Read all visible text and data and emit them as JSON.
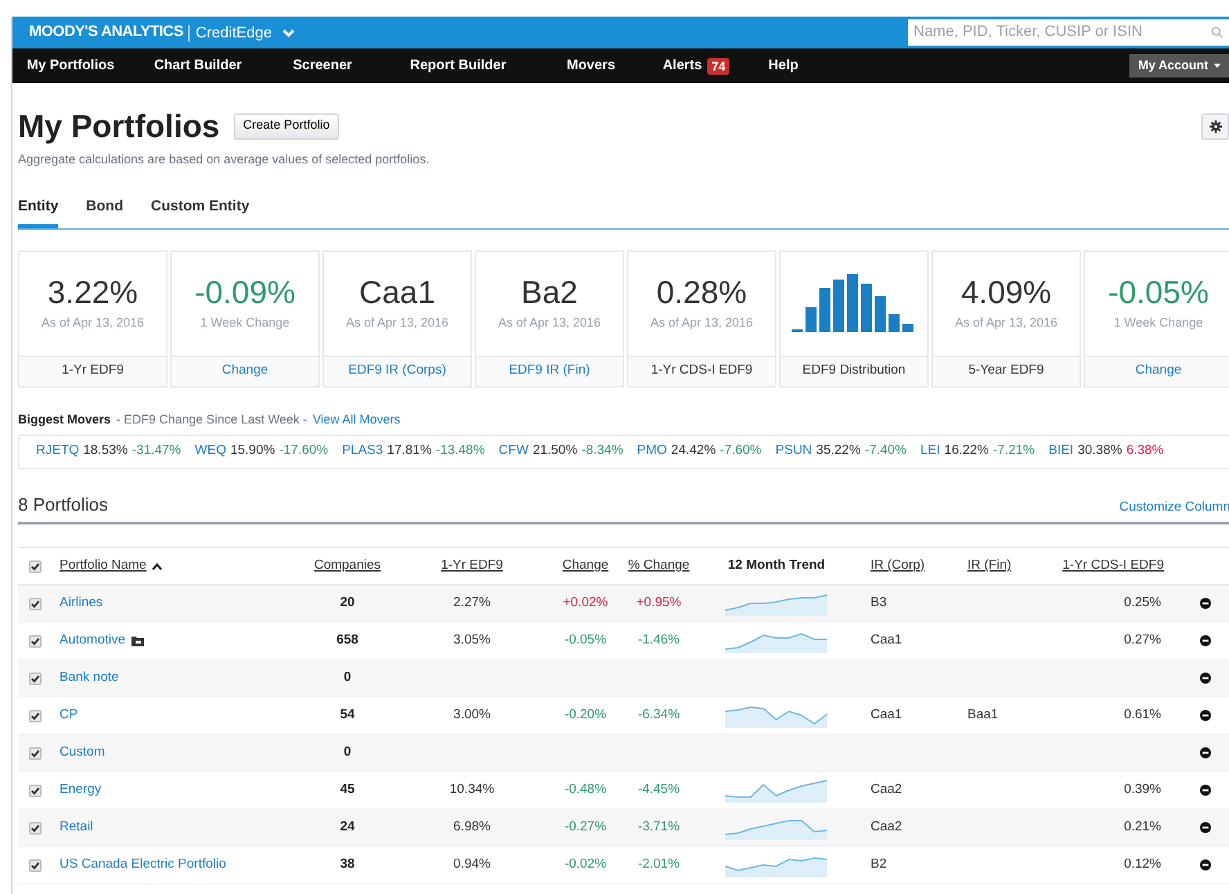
{
  "header": {
    "brand": "MOODY'S ANALYTICS",
    "product": "CreditEdge",
    "search": {
      "placeholder": "Name, PID, Ticker, CUSIP or ISIN"
    }
  },
  "nav": {
    "items": [
      {
        "label": "My Portfolios"
      },
      {
        "label": "Chart Builder"
      },
      {
        "label": "Screener"
      },
      {
        "label": "Report Builder"
      },
      {
        "label": "Movers"
      },
      {
        "label": "Alerts",
        "badge": "74"
      },
      {
        "label": "Help"
      }
    ],
    "account": "My Account"
  },
  "page": {
    "title": "My Portfolios",
    "create_button": "Create Portfolio",
    "subtitle": "Aggregate calculations are based on average values of selected portfolios."
  },
  "tabs": [
    {
      "label": "Entity",
      "selected": true
    },
    {
      "label": "Bond",
      "selected": false
    },
    {
      "label": "Custom Entity",
      "selected": false
    }
  ],
  "cards": [
    {
      "kind": "value",
      "value": "3.22%",
      "note": "As of Apr 13, 2016",
      "footer": "1-Yr EDF9",
      "footer_link": false
    },
    {
      "kind": "change",
      "value": "-0.09%",
      "note": "1 Week Change",
      "footer": "Change",
      "footer_link": true
    },
    {
      "kind": "value",
      "value": "Caa1",
      "note": "As of Apr 13, 2016",
      "footer": "EDF9 IR (Corps)",
      "footer_link": true
    },
    {
      "kind": "value",
      "value": "Ba2",
      "note": "As of Apr 13, 2016",
      "footer": "EDF9 IR (Fin)",
      "footer_link": true
    },
    {
      "kind": "value",
      "value": "0.28%",
      "note": "As of Apr 13, 2016",
      "footer": "1-Yr CDS-I EDF9",
      "footer_link": false
    },
    {
      "kind": "chart",
      "footer": "EDF9 Distribution",
      "footer_link": false
    },
    {
      "kind": "value",
      "value": "4.09%",
      "note": "As of Apr 13, 2016",
      "footer": "5-Year EDF9",
      "footer_link": false
    },
    {
      "kind": "change",
      "value": "-0.05%",
      "note": "1 Week Change",
      "footer": "Change",
      "footer_link": true
    }
  ],
  "movers": {
    "title": "Biggest Movers",
    "subtitle": "- EDF9 Change Since Last Week -",
    "link": "View All Movers",
    "items": [
      {
        "ticker": "RJETQ",
        "edf": "18.53%",
        "change": "-31.47%",
        "color": "#2e9a6e"
      },
      {
        "ticker": "WEQ",
        "edf": "15.90%",
        "change": "-17.60%",
        "color": "#2e9a6e"
      },
      {
        "ticker": "PLAS3",
        "edf": "17.81%",
        "change": "-13.48%",
        "color": "#2e9a6e"
      },
      {
        "ticker": "CFW",
        "edf": "21.50%",
        "change": "-8.34%",
        "color": "#2e9a6e"
      },
      {
        "ticker": "PMO",
        "edf": "24.42%",
        "change": "-7.60%",
        "color": "#2e9a6e"
      },
      {
        "ticker": "PSUN",
        "edf": "35.22%",
        "change": "-7.40%",
        "color": "#2e9a6e"
      },
      {
        "ticker": "LEI",
        "edf": "16.22%",
        "change": "-7.21%",
        "color": "#2e9a6e"
      },
      {
        "ticker": "BIEI",
        "edf": "30.38%",
        "change": "6.38%",
        "color": "#d0264a"
      }
    ]
  },
  "portfolios": {
    "count": "8 Portfolios",
    "customize": "Customize Column",
    "columns": [
      {
        "label": "Portfolio Name",
        "sorted": true
      },
      {
        "label": "Companies",
        "sorted": false
      },
      {
        "label": "1-Yr EDF9",
        "sorted": false
      },
      {
        "label": "Change",
        "sorted": false
      },
      {
        "label": "% Change",
        "sorted": false
      },
      {
        "label": "12 Month Trend",
        "sorted": false
      },
      {
        "label": "IR (Corp)",
        "sorted": false
      },
      {
        "label": "IR (Fin)",
        "sorted": false
      },
      {
        "label": "1-Yr CDS-I EDF9",
        "sorted": false
      }
    ],
    "all_checked": true,
    "rows": [
      {
        "checked": true,
        "name": "Airlines",
        "shared": false,
        "companies": "20",
        "edf": "2.27%",
        "change": "+0.02%",
        "pct_change": "+0.95%",
        "color": "#d0264a",
        "trend": true,
        "ir_corp": "B3",
        "cds": "0.25%"
      },
      {
        "checked": true,
        "name": "Automotive",
        "shared": true,
        "companies": "658",
        "edf": "3.05%",
        "change": "-0.05%",
        "pct_change": "-1.46%",
        "color": "#2e9a6e",
        "trend": true,
        "ir_corp": "Caa1",
        "cds": "0.27%"
      },
      {
        "checked": true,
        "name": "Bank note",
        "shared": false,
        "companies": "0",
        "trend": false
      },
      {
        "checked": true,
        "name": "CP",
        "shared": false,
        "companies": "54",
        "edf": "3.00%",
        "change": "-0.20%",
        "pct_change": "-6.34%",
        "color": "#2e9a6e",
        "trend": true,
        "ir_corp": "Caa1",
        "ir_fin": "Baa1",
        "cds": "0.61%"
      },
      {
        "checked": true,
        "name": "Custom",
        "shared": false,
        "companies": "0",
        "trend": false
      },
      {
        "checked": true,
        "name": "Energy",
        "shared": false,
        "companies": "45",
        "edf": "10.34%",
        "change": "-0.48%",
        "pct_change": "-4.45%",
        "color": "#2e9a6e",
        "trend": true,
        "ir_corp": "Caa2",
        "cds": "0.39%"
      },
      {
        "checked": true,
        "name": "Retail",
        "shared": false,
        "companies": "24",
        "edf": "6.98%",
        "change": "-0.27%",
        "pct_change": "-3.71%",
        "color": "#2e9a6e",
        "trend": true,
        "ir_corp": "Caa2",
        "cds": "0.21%"
      },
      {
        "checked": true,
        "name": "US Canada Electric Portfolio",
        "shared": false,
        "companies": "38",
        "edf": "0.94%",
        "change": "-0.02%",
        "pct_change": "-2.01%",
        "color": "#2e9a6e",
        "trend": true,
        "ir_corp": "B2",
        "cds": "0.12%"
      }
    ]
  }
}
